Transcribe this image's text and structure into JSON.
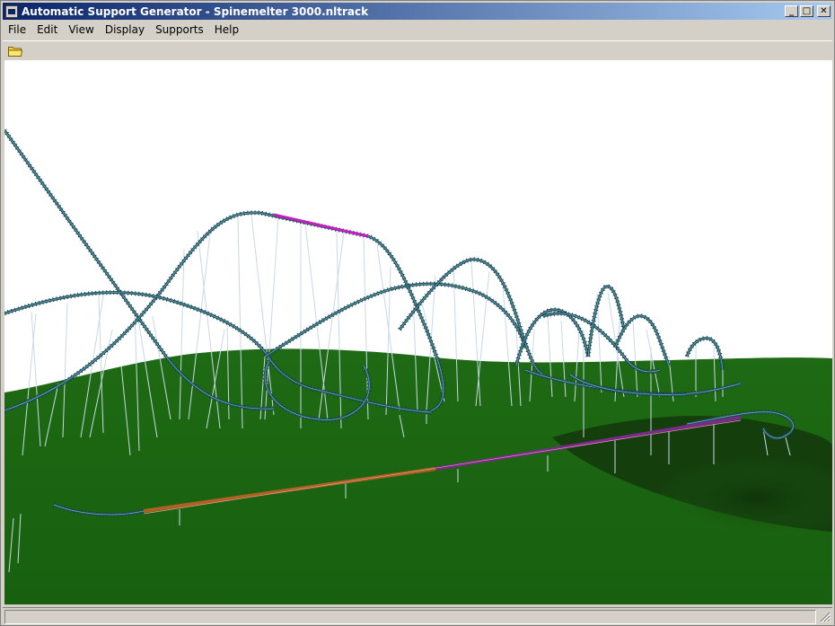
{
  "window": {
    "title": "Automatic Support Generator - Spinemelter 3000.nltrack",
    "minimize_label": "_",
    "maximize_label": "□",
    "close_label": "✕"
  },
  "menu": {
    "items": [
      "File",
      "Edit",
      "View",
      "Display",
      "Supports",
      "Help"
    ]
  },
  "toolbar": {
    "open_icon": "folder-open-icon"
  },
  "scene": {
    "sky_color": "#ffffff",
    "ground_color": "#2a6e1a",
    "ground_dark": "#123d0c",
    "track_color": "#1e4f5a",
    "tie_color": "#0e3a45",
    "support_color": "#c8d8e8",
    "highlight_pink": "#c020c0",
    "highlight_orange": "#b06020"
  },
  "statusbar": {
    "text": ""
  }
}
